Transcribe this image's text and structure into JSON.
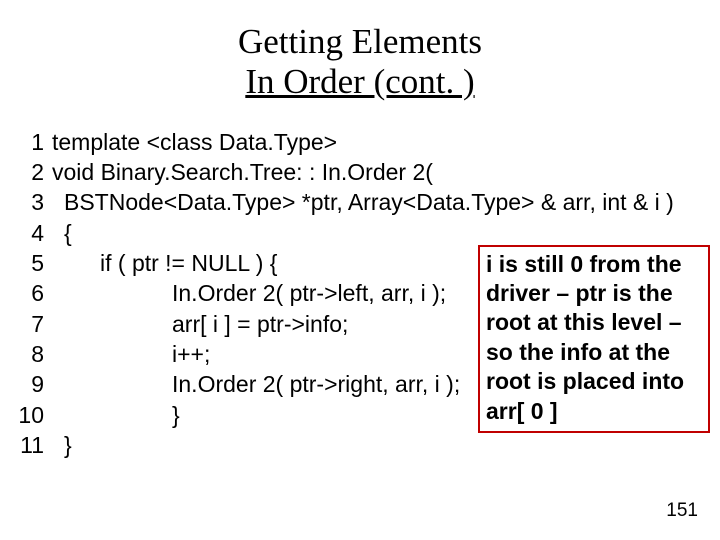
{
  "title": {
    "line1": "Getting Elements",
    "line2": "In Order (cont. )"
  },
  "code": {
    "lines": [
      {
        "n": "1",
        "indent": 0,
        "text": "template <class Data.Type>"
      },
      {
        "n": "2",
        "indent": 0,
        "text": "void Binary.Search.Tree: : In.Order 2("
      },
      {
        "n": "3",
        "indent": 1,
        "text": "BSTNode<Data.Type> *ptr, Array<Data.Type> & arr, int & i )"
      },
      {
        "n": "4",
        "indent": 1,
        "text": "{"
      },
      {
        "n": "5",
        "indent": 4,
        "text": "if ( ptr != NULL ) {"
      },
      {
        "n": "6",
        "indent": 10,
        "text": "In.Order 2( ptr->left, arr, i );"
      },
      {
        "n": "7",
        "indent": 10,
        "text": "arr[ i ] = ptr->info;"
      },
      {
        "n": "8",
        "indent": 10,
        "text": "i++;"
      },
      {
        "n": "9",
        "indent": 10,
        "text": "In.Order 2( ptr->right, arr, i );"
      },
      {
        "n": "10",
        "indent": 10,
        "text": "}"
      },
      {
        "n": "11",
        "indent": 1,
        "text": "}"
      }
    ]
  },
  "annotation": "i is still 0 from the driver – ptr is the root at this level – so the info at the root is placed into arr[ 0 ]",
  "page_number": "151"
}
